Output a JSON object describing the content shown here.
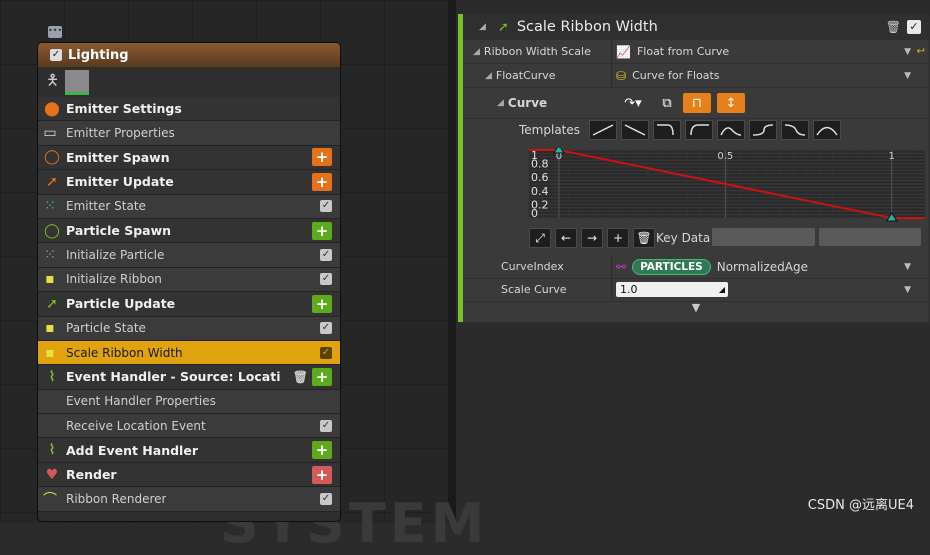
{
  "background_text": "SYSTEM",
  "node": {
    "title": "Lighting",
    "rows": [
      {
        "kind": "header",
        "label": "Emitter Settings",
        "icon": "emitter-settings-icon",
        "color": "#e5721a"
      },
      {
        "kind": "item",
        "label": "Emitter Properties",
        "icon": "cpu-icon"
      },
      {
        "kind": "header",
        "label": "Emitter Spawn",
        "icon": "spawn-ring-icon",
        "color": "#e5721a",
        "plus": "orange"
      },
      {
        "kind": "header",
        "label": "Emitter Update",
        "icon": "update-arrow-icon",
        "color": "#e5721a",
        "plus": "orange"
      },
      {
        "kind": "item",
        "label": "Emitter State",
        "icon": "module-dots-icon",
        "tick": true
      },
      {
        "kind": "header",
        "label": "Particle Spawn",
        "icon": "spawn-ring-icon",
        "color": "#7bc02a",
        "plus": "green"
      },
      {
        "kind": "item",
        "label": "Initialize Particle",
        "icon": "module-dots-icon",
        "tick": true
      },
      {
        "kind": "item",
        "label": "Initialize Ribbon",
        "icon": "module-dot-icon",
        "tick": true
      },
      {
        "kind": "header",
        "label": "Particle Update",
        "icon": "update-arrow-icon",
        "color": "#7bc02a",
        "plus": "green"
      },
      {
        "kind": "item",
        "label": "Particle State",
        "icon": "module-dot-icon",
        "tick": true
      },
      {
        "kind": "item",
        "label": "Scale Ribbon Width",
        "icon": "module-dot-icon",
        "tick": true,
        "selected": true
      },
      {
        "kind": "header",
        "label": "Event Handler - Source: LocationEvent",
        "icon": "event-signal-icon",
        "color": "#7bc02a",
        "plus": "green",
        "trash": true
      },
      {
        "kind": "item",
        "label": "Event Handler Properties",
        "icon": ""
      },
      {
        "kind": "item",
        "label": "Receive Location Event",
        "icon": "",
        "tick": true
      },
      {
        "kind": "header",
        "label": "Add Event Handler",
        "icon": "event-signal-icon",
        "color": "#7bc02a",
        "plus": "green"
      },
      {
        "kind": "header",
        "label": "Render",
        "icon": "render-heart-icon",
        "color": "#d25a5a",
        "plus": "red"
      },
      {
        "kind": "item",
        "label": "Ribbon Renderer",
        "icon": "ribbon-icon",
        "tick": true
      }
    ]
  },
  "panel": {
    "title": "Scale Ribbon Width",
    "ribbon_width_scale_label": "Ribbon Width Scale",
    "ribbon_width_scale_value": "Float from Curve",
    "float_curve_label": "FloatCurve",
    "float_curve_value": "Curve for Floats",
    "curve_label": "Curve",
    "templates_label": "Templates",
    "key_data_label": "Key Data",
    "curve_index_label": "CurveIndex",
    "curve_index_badge": "PARTICLES",
    "curve_index_value": "NormalizedAge",
    "scale_curve_label": "Scale Curve",
    "scale_curve_value": "1.0"
  },
  "chart_data": {
    "type": "line",
    "x": [
      0,
      1
    ],
    "y": [
      1,
      0
    ],
    "xlim": [
      -0.09,
      1.1
    ],
    "ylim": [
      0,
      1
    ],
    "x_ticks": [
      "0",
      "0.5",
      "1"
    ],
    "y_ticks": [
      "1",
      "0.8",
      "0.6",
      "0.4",
      "0.2",
      "0"
    ],
    "line_color": "#d01010",
    "key_color": "#1fb5a5"
  },
  "watermark": "CSDN @远离UE4"
}
